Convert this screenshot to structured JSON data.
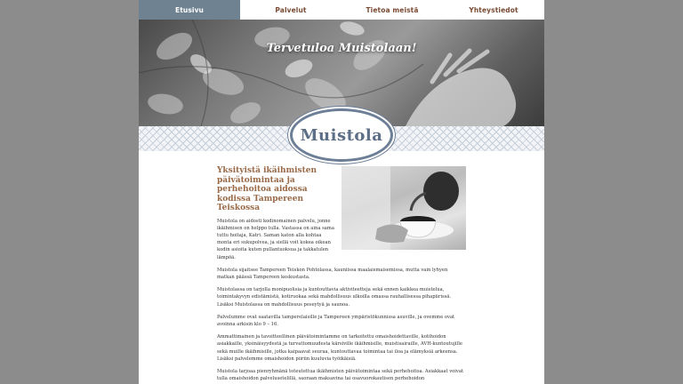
{
  "nav": {
    "items": [
      {
        "label": "Etusivu"
      },
      {
        "label": "Palvelut"
      },
      {
        "label": "Tietoa meistä"
      },
      {
        "label": "Yhteystiedot"
      }
    ]
  },
  "hero": {
    "title": "Tervetuloa Muistolaan!"
  },
  "logo": {
    "text": "Muistola"
  },
  "content": {
    "heading": "Yksityistä ikäihmisten päivätoimintaa ja perhehoitoa aidossa kodissa Tampereen Teiskossa",
    "intro": "Muistola on aidosti kodinomainen palvelu, jonne ikäihmisen on helppo tulla. Vastassa on aina sama tuttu hoitaja, Katri. Saman katon alla kohtaa monta eri sukupolvea, ja siellä voit kokea oikean kodin asioita kuten pullantuoksua ja takkatulen lämpöä.",
    "paragraphs": [
      "Muistola sijaitsee Tampereen Teiskon Pohtolassa, kauniissa maalaismaisemissa, mutta vain lyhyen matkan päässä Tampereen keskustasta.",
      "Muistolassa on tarjolla monipuolisia ja kuntouttavia aktiviteetteja sekä ennen kaikkea muistelua, toimintakyvyn edistämistä, kotiruokaa sekä mahdollisuus ulkoilla omassa rauhallisessa pihapiirissä. Lisäksi Muistolassa on mahdollisuus peseytyä ja saunoa.",
      "Palvelumme ovat saatavilla tamperelaisille ja Tampereen ympäristökunnissa asuville, ja ovemme ovat avoinna arkisin klo 9 – 16.",
      "Ammattimainen ja tavoitteellinen päivätoimintamme on tarkoitettu omaishoidettaville, kotihoidon asiakkaille, yksinäisyydestä ja turvattomuudesta kärsiville ikäihmisille, muistisairaille, AVH-kuntoutujille sekä muille ikäihmisille, jotka kaipaavat seuraa, kuntouttavaa toimintaa tai iloa ja elämyksiä arkeensa. Lisäksi palvelemme omaishoidon piiriin kuuluvia työikäisiä.",
      "Muistola tarjoaa pienryhmänä toteutettua ikäihmisten päivätoimintaa sekä perhehoitoa. Asiakkaat voivat tulla omaishoidon palvelusetelillä, saoraan maksavina tai osavuorokautisen perhehoidon"
    ]
  }
}
